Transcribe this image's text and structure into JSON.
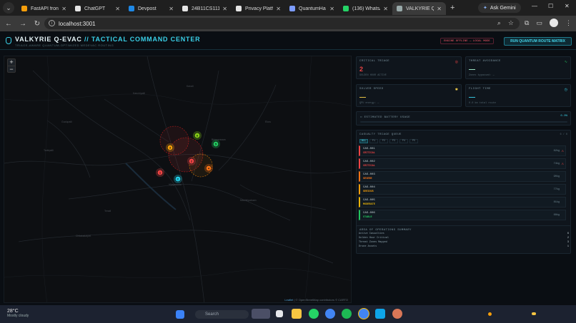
{
  "browser": {
    "tabs": [
      {
        "title": "FastAPI fronte",
        "color": "#f59e0b",
        "active": false
      },
      {
        "title": "ChatGPT",
        "color": "#e5e5e5",
        "active": false
      },
      {
        "title": "Devpost",
        "color": "#1e88e5",
        "active": false
      },
      {
        "title": "24B11CS111/",
        "color": "#e5e5e5",
        "active": false
      },
      {
        "title": "Privacy Platfo",
        "color": "#e5e5e5",
        "active": false
      },
      {
        "title": "QuantumHa",
        "color": "#7c9cff",
        "active": false
      },
      {
        "title": "(136) WhatsA",
        "color": "#25d366",
        "active": false
      },
      {
        "title": "VALKYRIE Q-E",
        "color": "#9aa",
        "active": true
      }
    ],
    "url": "localhost:3001",
    "ask_gemini": "Ask Gemini"
  },
  "header": {
    "title_main": "VALKYRIE Q-EVAC",
    "title_accent": "// TACTICAL COMMAND CENTER",
    "subtitle": "TRIAGE-AWARE QUANTUM-OPTIMIZED MEDEVAC ROUTING",
    "engine_status": "ENGINE OFFLINE — LOCAL MODE",
    "run_button": "RUN QUANTUM ROUTE MATRIX"
  },
  "map": {
    "zoom_in": "+",
    "zoom_out": "−",
    "attribution_leaflet": "Leaflet",
    "attribution_rest": "| © OpenStreetMap contributors © CARTO",
    "markers": [
      {
        "label": "1",
        "color": "#ef4444"
      },
      {
        "label": "2",
        "color": "#ef4444"
      },
      {
        "label": "3",
        "color": "#f59e0b"
      },
      {
        "label": "4",
        "color": "#f97316"
      },
      {
        "label": "5",
        "color": "#22c55e"
      },
      {
        "label": "6",
        "color": "#84cc16"
      },
      {
        "label": "C",
        "color": "#22d3ee"
      }
    ]
  },
  "stats": {
    "critical_triage": {
      "label": "CRITICAL TRIAGE",
      "value": "2",
      "sub": "GOLDEN HOUR ACTIVE",
      "color": "#ef4444"
    },
    "threat_avoidance": {
      "label": "THREAT AVOIDANCE",
      "value": "—",
      "sub": "Zones bypassed: —",
      "color": "#a7f3d0"
    },
    "solver_speed": {
      "label": "SOLVER SPEED",
      "value": "—",
      "sub": "QPU energy: —",
      "color": "#f5d04a"
    },
    "flight_time": {
      "label": "FLIGHT TIME",
      "value": "—",
      "sub": "0.0 km total route",
      "color": "#3ad0e8"
    },
    "battery": {
      "label": "ESTIMATED BATTERY USAGE",
      "value": "0.0%"
    }
  },
  "queue": {
    "title": "CASUALTY TRIAGE QUEUE",
    "count": "6 / 6",
    "tabs": [
      "ALL",
      "P1",
      "P2",
      "P3",
      "P4",
      "P5"
    ],
    "rows": [
      {
        "id": "CAS-001",
        "severity": "CRITICAL",
        "weight": "82kg",
        "sev_color": "#ef4444",
        "border": "#ef4444"
      },
      {
        "id": "CAS-002",
        "severity": "CRITICAL",
        "weight": "74kg",
        "sev_color": "#ef4444",
        "border": "#ef4444"
      },
      {
        "id": "CAS-003",
        "severity": "SEVERE",
        "weight": "90kg",
        "sev_color": "#f97316",
        "border": "#f97316"
      },
      {
        "id": "CAS-004",
        "severity": "SERIOUS",
        "weight": "77kg",
        "sev_color": "#f59e0b",
        "border": "#f59e0b"
      },
      {
        "id": "CAS-005",
        "severity": "MODERATE",
        "weight": "81kg",
        "sev_color": "#eab308",
        "border": "#eab308"
      },
      {
        "id": "CAS-006",
        "severity": "STABLE",
        "weight": "68kg",
        "sev_color": "#22c55e",
        "border": "#22c55e"
      }
    ]
  },
  "aoo": {
    "title": "AREA OF OPERATIONS SUMMARY",
    "rows": [
      {
        "label": "Active Casualties",
        "value": "6"
      },
      {
        "label": "Golden Hour Critical",
        "value": "2"
      },
      {
        "label": "Threat Zones Mapped",
        "value": "3"
      },
      {
        "label": "Drone Assets",
        "value": "1"
      }
    ]
  },
  "taskbar": {
    "temp": "28°C",
    "weather": "Mostly cloudy",
    "search": "Search"
  }
}
